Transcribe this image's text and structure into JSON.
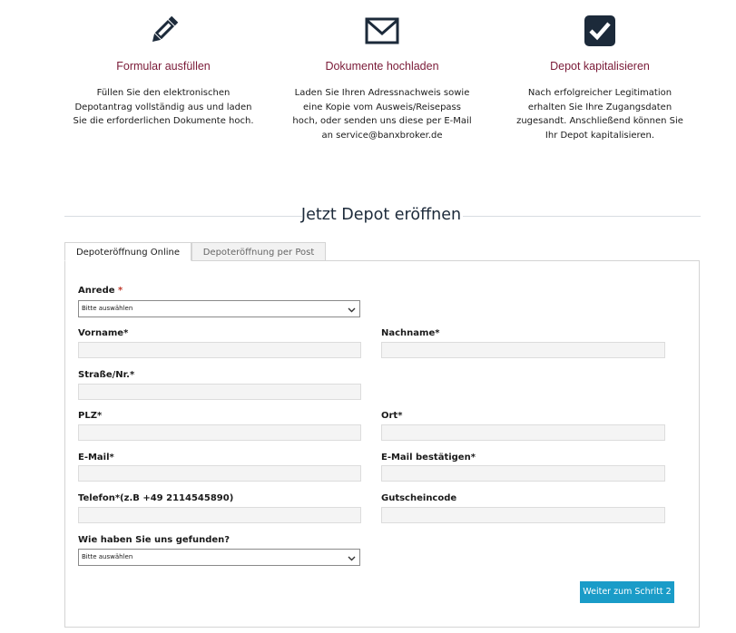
{
  "steps": [
    {
      "icon": "pencil-icon",
      "title": "Formular ausfüllen",
      "description": "Füllen Sie den elektronischen Depotantrag vollständig aus und laden Sie die erforderlichen Dokumente hoch."
    },
    {
      "icon": "envelope-icon",
      "title": "Dokumente hochladen",
      "description": "Laden Sie Ihren Adressnachweis sowie eine Kopie vom Ausweis/Reisepass hoch, oder senden uns diese per E-Mail an service@banxbroker.de"
    },
    {
      "icon": "checkbox-icon",
      "title": "Depot kapitalisieren",
      "description": "Nach erfolgreicher Legitimation erhalten Sie Ihre Zugangsdaten zugesandt. Anschließend können Sie Ihr Depot kapitalisieren."
    }
  ],
  "section_title": "Jetzt Depot eröffnen",
  "tabs": [
    {
      "label": "Depoteröffnung Online",
      "active": true
    },
    {
      "label": "Depoteröffnung per Post",
      "active": false
    }
  ],
  "form": {
    "anrede": {
      "label": "Anrede",
      "required_mark": "*",
      "value": "Bitte auswählen"
    },
    "vorname": {
      "label": "Vorname*",
      "value": ""
    },
    "nachname": {
      "label": "Nachname*",
      "value": ""
    },
    "strasse": {
      "label": "Straße/Nr.*",
      "value": ""
    },
    "plz": {
      "label": "PLZ*",
      "value": ""
    },
    "ort": {
      "label": "Ort*",
      "value": ""
    },
    "email": {
      "label": "E-Mail*",
      "value": ""
    },
    "email_confirm": {
      "label": "E-Mail bestätigen*",
      "value": ""
    },
    "telefon": {
      "label": "Telefon*(z.B +49 2114545890)",
      "value": ""
    },
    "gutscheincode": {
      "label": "Gutscheincode",
      "value": ""
    },
    "found_us": {
      "label": "Wie haben Sie uns gefunden?",
      "value": "Bitte auswählen"
    }
  },
  "submit_label": "Weiter zum Schritt 2",
  "colors": {
    "accent_title": "#7a1a37",
    "icon_navy": "#1c2a3a",
    "button": "#1a9cc8",
    "required": "#c0392b"
  }
}
